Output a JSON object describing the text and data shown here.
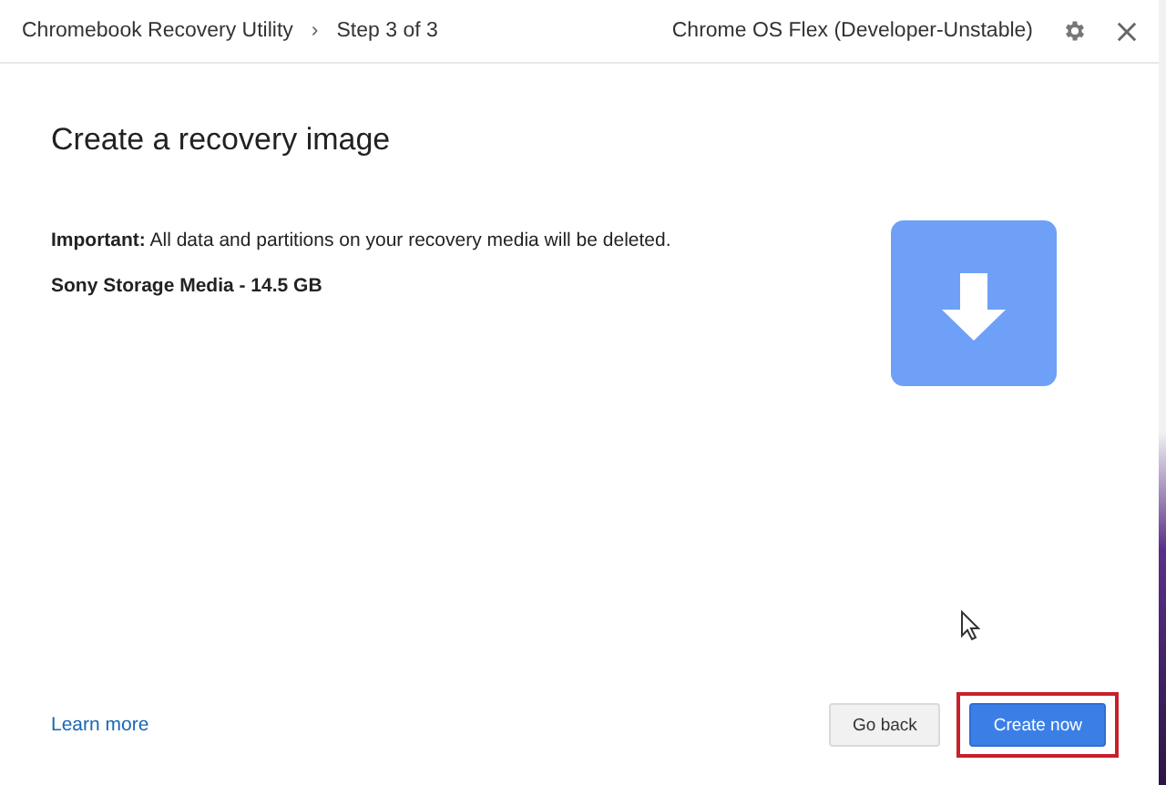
{
  "header": {
    "app_title": "Chromebook Recovery Utility",
    "breadcrumb_separator": "›",
    "step": "Step 3 of 3",
    "image_name": "Chrome OS Flex (Developer-Unstable)"
  },
  "heading": "Create a recovery image",
  "warning": "**Important:** All data and partitions on your recovery media will be deleted.",
  "device": "Sony Storage Media - 14.5 GB",
  "footer": {
    "link": "Learn more",
    "buttons": [
      {
        "label": "Go back",
        "kind": "secondary",
        "highlighted": false
      },
      {
        "label": "Create now",
        "kind": "primary",
        "highlighted": true
      }
    ]
  }
}
